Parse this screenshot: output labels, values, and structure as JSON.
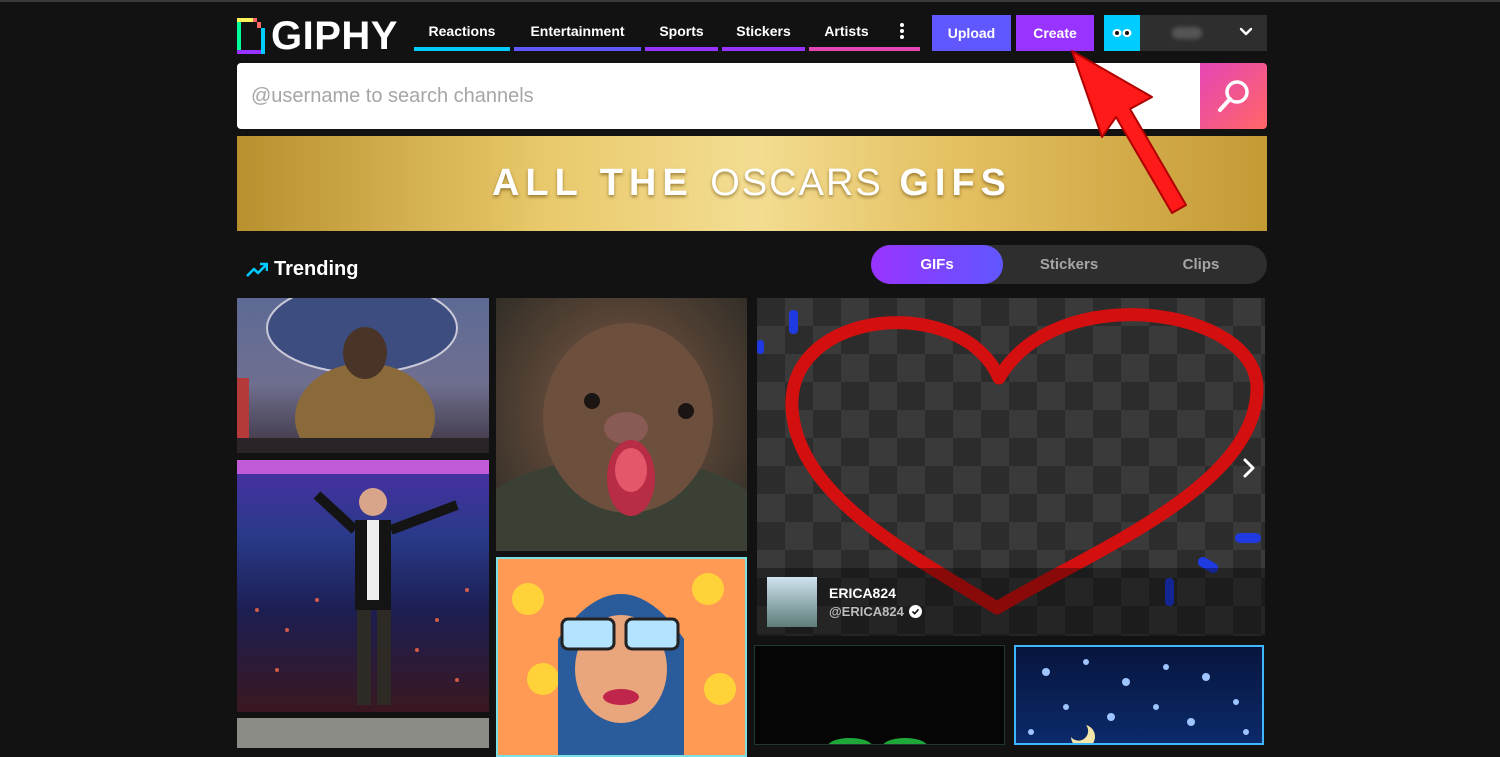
{
  "header": {
    "logo_text": "GIPHY",
    "nav": [
      {
        "label": "Reactions",
        "color": "#00ccff"
      },
      {
        "label": "Entertainment",
        "color": "#6157ff"
      },
      {
        "label": "Sports",
        "color": "#9933ff"
      },
      {
        "label": "Stickers",
        "color": "#9933ff"
      },
      {
        "label": "Artists",
        "color": "#e646b6"
      }
    ],
    "more_icon": "vertical-dots-icon",
    "upload_label": "Upload",
    "create_label": "Create"
  },
  "search": {
    "placeholder": "@username to search channels",
    "icon": "search-icon"
  },
  "banner": {
    "part1": "ALL THE",
    "part2": "OSCARS",
    "part3": "GIFS"
  },
  "trending": {
    "title": "Trending",
    "icon": "trending-arrow-icon",
    "tabs": [
      "GIFs",
      "Stickers",
      "Clips"
    ],
    "active_tab": "GIFs"
  },
  "featured": {
    "display_name": "ERICA824",
    "handle": "@ERICA824"
  },
  "colors": {
    "background": "#121212",
    "upload": "#6157ff",
    "create": "#9933ff",
    "annotation_arrow": "#ff1a1a"
  }
}
